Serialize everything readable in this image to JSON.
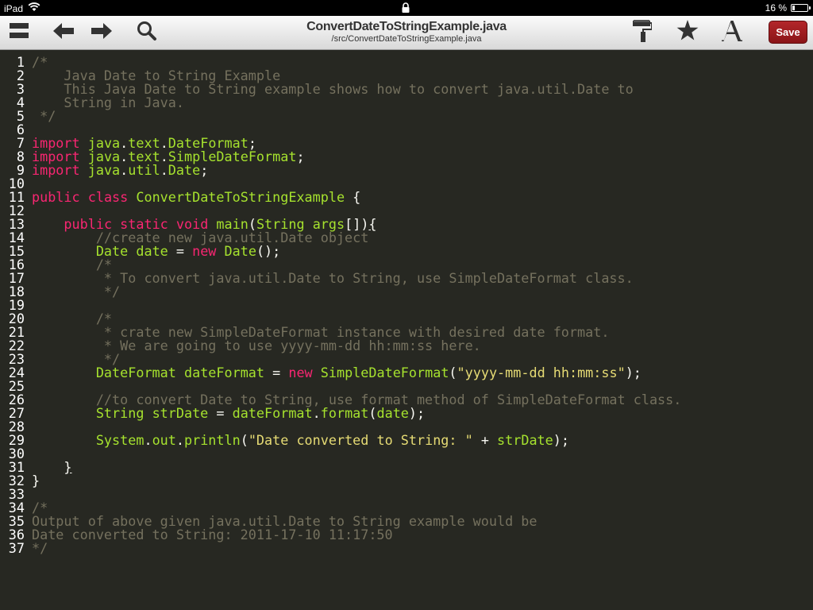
{
  "status": {
    "device": "iPad",
    "battery": "16 %",
    "battery_level": 0.16
  },
  "toolbar": {
    "title": "ConvertDateToStringExample.java",
    "path": "/src/ConvertDateToStringExample.java",
    "save_label": "Save"
  },
  "editor": {
    "lines": [
      [
        [
          "c",
          "/*"
        ]
      ],
      [
        [
          "c",
          "    Java Date to String Example"
        ]
      ],
      [
        [
          "c",
          "    This Java Date to String example shows how to convert java.util.Date to"
        ]
      ],
      [
        [
          "c",
          "    String in Java."
        ]
      ],
      [
        [
          "c",
          " */"
        ]
      ],
      [],
      [
        [
          "k",
          "import"
        ],
        [
          "p",
          " "
        ],
        [
          "t",
          "java"
        ],
        [
          "p",
          "."
        ],
        [
          "t",
          "text"
        ],
        [
          "p",
          "."
        ],
        [
          "t",
          "DateFormat"
        ],
        [
          "p",
          ";"
        ]
      ],
      [
        [
          "k",
          "import"
        ],
        [
          "p",
          " "
        ],
        [
          "t",
          "java"
        ],
        [
          "p",
          "."
        ],
        [
          "t",
          "text"
        ],
        [
          "p",
          "."
        ],
        [
          "t",
          "SimpleDateFormat"
        ],
        [
          "p",
          ";"
        ]
      ],
      [
        [
          "k",
          "import"
        ],
        [
          "p",
          " "
        ],
        [
          "t",
          "java"
        ],
        [
          "p",
          "."
        ],
        [
          "t",
          "util"
        ],
        [
          "p",
          "."
        ],
        [
          "t",
          "Date"
        ],
        [
          "p",
          ";"
        ]
      ],
      [],
      [
        [
          "k",
          "public"
        ],
        [
          "p",
          " "
        ],
        [
          "k",
          "class"
        ],
        [
          "p",
          " "
        ],
        [
          "t",
          "ConvertDateToStringExample"
        ],
        [
          "p",
          " {"
        ]
      ],
      [],
      [
        [
          "p",
          "    "
        ],
        [
          "k",
          "public"
        ],
        [
          "p",
          " "
        ],
        [
          "k",
          "static"
        ],
        [
          "p",
          " "
        ],
        [
          "k",
          "void"
        ],
        [
          "p",
          " "
        ],
        [
          "t",
          "main"
        ],
        [
          "p",
          "("
        ],
        [
          "t",
          "String"
        ],
        [
          "p",
          " "
        ],
        [
          "t",
          "args"
        ],
        [
          "p",
          "[])"
        ],
        [
          "caret",
          "{"
        ]
      ],
      [
        [
          "c",
          "        //create new java.util.Date object"
        ]
      ],
      [
        [
          "p",
          "        "
        ],
        [
          "t",
          "Date"
        ],
        [
          "p",
          " "
        ],
        [
          "t",
          "date"
        ],
        [
          "p",
          " = "
        ],
        [
          "k",
          "new"
        ],
        [
          "p",
          " "
        ],
        [
          "t",
          "Date"
        ],
        [
          "p",
          "();"
        ]
      ],
      [
        [
          "c",
          "        /*"
        ]
      ],
      [
        [
          "c",
          "         * To convert java.util.Date to String, use SimpleDateFormat class."
        ]
      ],
      [
        [
          "c",
          "         */"
        ]
      ],
      [],
      [
        [
          "c",
          "        /*"
        ]
      ],
      [
        [
          "c",
          "         * crate new SimpleDateFormat instance with desired date format."
        ]
      ],
      [
        [
          "c",
          "         * We are going to use yyyy-mm-dd hh:mm:ss here."
        ]
      ],
      [
        [
          "c",
          "         */"
        ]
      ],
      [
        [
          "p",
          "        "
        ],
        [
          "t",
          "DateFormat"
        ],
        [
          "p",
          " "
        ],
        [
          "t",
          "dateFormat"
        ],
        [
          "p",
          " = "
        ],
        [
          "k",
          "new"
        ],
        [
          "p",
          " "
        ],
        [
          "t",
          "SimpleDateFormat"
        ],
        [
          "p",
          "("
        ],
        [
          "s",
          "\"yyyy-mm-dd hh:mm:ss\""
        ],
        [
          "p",
          ");"
        ]
      ],
      [],
      [
        [
          "c",
          "        //to convert Date to String, use format method of SimpleDateFormat class."
        ]
      ],
      [
        [
          "p",
          "        "
        ],
        [
          "t",
          "String"
        ],
        [
          "p",
          " "
        ],
        [
          "t",
          "strDate"
        ],
        [
          "p",
          " = "
        ],
        [
          "t",
          "dateFormat"
        ],
        [
          "p",
          "."
        ],
        [
          "t",
          "format"
        ],
        [
          "p",
          "("
        ],
        [
          "t",
          "date"
        ],
        [
          "p",
          ");"
        ]
      ],
      [],
      [
        [
          "p",
          "        "
        ],
        [
          "t",
          "System"
        ],
        [
          "p",
          "."
        ],
        [
          "t",
          "out"
        ],
        [
          "p",
          "."
        ],
        [
          "t",
          "println"
        ],
        [
          "p",
          "("
        ],
        [
          "s",
          "\"Date converted to String: \""
        ],
        [
          "p",
          " + "
        ],
        [
          "t",
          "strDate"
        ],
        [
          "p",
          ");"
        ]
      ],
      [],
      [
        [
          "p",
          "    "
        ],
        [
          "caret",
          "}"
        ]
      ],
      [
        [
          "p",
          "}"
        ]
      ],
      [],
      [
        [
          "c",
          "/*"
        ]
      ],
      [
        [
          "c",
          "Output of above given java.util.Date to String example would be"
        ]
      ],
      [
        [
          "c",
          "Date converted to String: 2011-17-10 11:17:50"
        ]
      ],
      [
        [
          "c",
          "*/"
        ]
      ]
    ]
  }
}
